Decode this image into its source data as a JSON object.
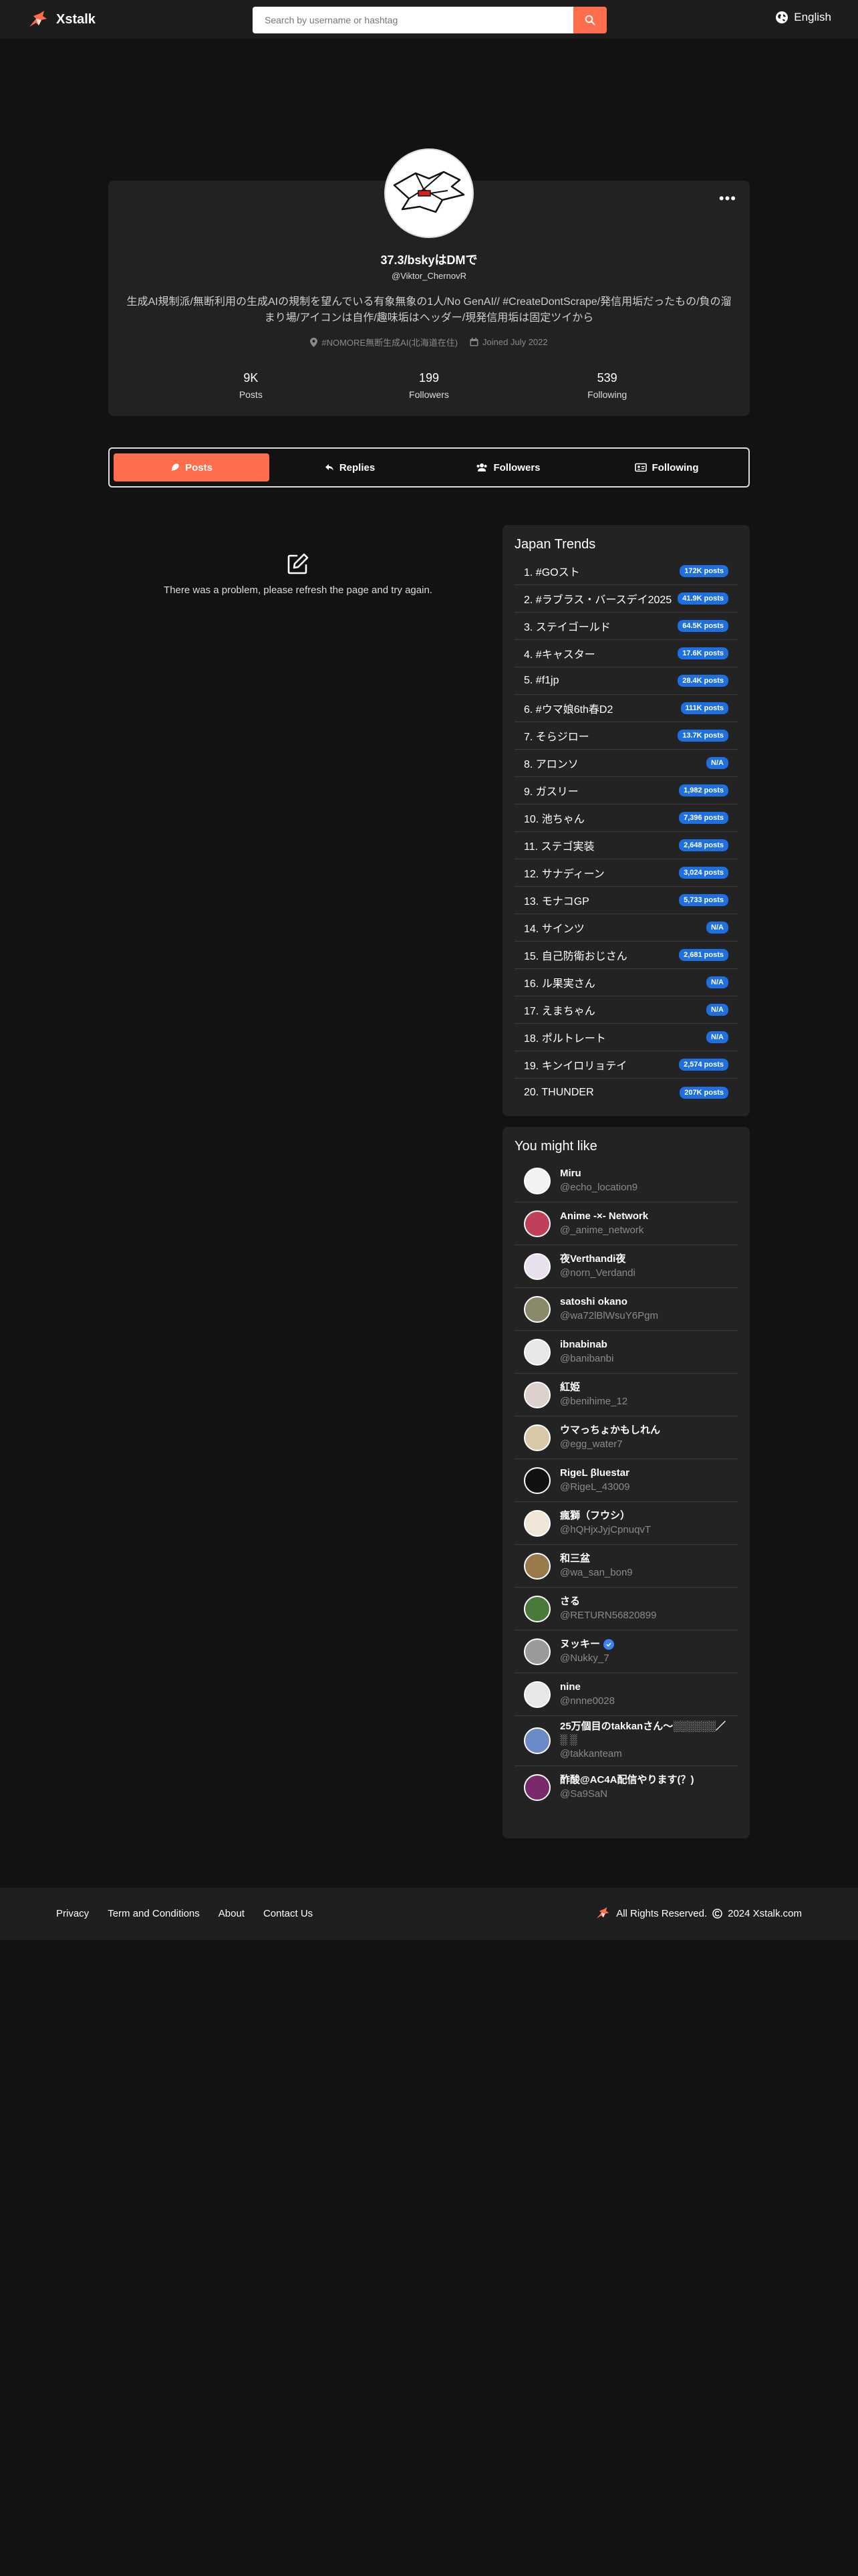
{
  "header": {
    "brand": "Xstalk",
    "search_placeholder": "Search by username or hashtag",
    "language": "English"
  },
  "profile": {
    "display_name": "37.3/bskyはDMで",
    "handle": "@Viktor_ChernovR",
    "bio": "生成AI規制派/無断利用の生成AIの規制を望んでいる有象無象の1人/No GenAI// #CreateDontScrape/発信用垢だったもの/負の溜まり場/アイコンは自作/趣味垢はヘッダー/現発信用垢は固定ツイから",
    "location": "#NOMORE無断生成AI(北海道在住)",
    "joined": "Joined July 2022",
    "stats": [
      {
        "value": "9K",
        "label": "Posts"
      },
      {
        "value": "199",
        "label": "Followers"
      },
      {
        "value": "539",
        "label": "Following"
      }
    ]
  },
  "tabs": [
    {
      "label": "Posts",
      "icon": "feather-icon",
      "active": true
    },
    {
      "label": "Replies",
      "icon": "reply-icon",
      "active": false
    },
    {
      "label": "Followers",
      "icon": "users-icon",
      "active": false
    },
    {
      "label": "Following",
      "icon": "id-card-icon",
      "active": false
    }
  ],
  "error_message": "There was a problem, please refresh the page and try again.",
  "trends": {
    "title": "Japan Trends",
    "items": [
      {
        "name": "1. #GOスト",
        "count": "172K posts"
      },
      {
        "name": "2. #ラブラス・バースデイ2025",
        "count": "41.9K posts"
      },
      {
        "name": "3. ステイゴールド",
        "count": "64.5K posts"
      },
      {
        "name": "4. #キャスター",
        "count": "17.6K posts"
      },
      {
        "name": "5. #f1jp",
        "count": "28.4K posts"
      },
      {
        "name": "6. #ウマ娘6th春D2",
        "count": "111K posts"
      },
      {
        "name": "7. そらジロー",
        "count": "13.7K posts"
      },
      {
        "name": "8. アロンソ",
        "count": "N/A"
      },
      {
        "name": "9. ガスリー",
        "count": "1,982 posts"
      },
      {
        "name": "10. 池ちゃん",
        "count": "7,396 posts"
      },
      {
        "name": "11. ステゴ実装",
        "count": "2,648 posts"
      },
      {
        "name": "12. サナディーン",
        "count": "3,024 posts"
      },
      {
        "name": "13. モナコGP",
        "count": "5,733 posts"
      },
      {
        "name": "14. サインツ",
        "count": "N/A"
      },
      {
        "name": "15. 自己防衛おじさん",
        "count": "2,681 posts"
      },
      {
        "name": "16. ル果実さん",
        "count": "N/A"
      },
      {
        "name": "17. えまちゃん",
        "count": "N/A"
      },
      {
        "name": "18. ポルトレート",
        "count": "N/A"
      },
      {
        "name": "19. キンイロリョテイ",
        "count": "2,574 posts"
      },
      {
        "name": "20. THUNDER",
        "count": "207K posts"
      }
    ]
  },
  "suggest": {
    "title": "You might like",
    "users": [
      {
        "name": "Miru",
        "handle": "@echo_location9",
        "color": "#f2f2f2",
        "verified": false
      },
      {
        "name": "Anime -×- Network",
        "handle": "@_anime_network",
        "color": "#c0405a",
        "verified": false
      },
      {
        "name": "夜Verthandi夜",
        "handle": "@norn_Verdandi",
        "color": "#e8e0ec",
        "verified": false
      },
      {
        "name": "satoshi okano",
        "handle": "@wa72lBlWsuY6Pgm",
        "color": "#8a8a6a",
        "verified": false
      },
      {
        "name": "ibnabinab",
        "handle": "@banibanbi",
        "color": "#e8e8e8",
        "verified": false
      },
      {
        "name": "紅姫",
        "handle": "@benihime_12",
        "color": "#ddd0cc",
        "verified": false
      },
      {
        "name": "ウマっちょかもしれん",
        "handle": "@egg_water7",
        "color": "#d8c8a8",
        "verified": false
      },
      {
        "name": "RigeL βluestar",
        "handle": "@RigeL_43009",
        "color": "#111111",
        "verified": false
      },
      {
        "name": "瘋獅（フウシ）",
        "handle": "@hQHjxJyjCpnuqvT",
        "color": "#f0e6d8",
        "verified": false
      },
      {
        "name": "和三盆",
        "handle": "@wa_san_bon9",
        "color": "#9a7a4a",
        "verified": false
      },
      {
        "name": "さる",
        "handle": "@RETURN56820899",
        "color": "#4a7a3a",
        "verified": false
      },
      {
        "name": "ヌッキー",
        "handle": "@Nukky_7",
        "color": "#9a9a9a",
        "verified": true
      },
      {
        "name": "nine",
        "handle": "@nnne0028",
        "color": "#e8e8e8",
        "verified": false
      },
      {
        "name": "25万個目のtakkanさん〜░░░░░░／ ░ ░",
        "handle": "@takkanteam",
        "color": "#6a8ac8",
        "verified": false
      },
      {
        "name": "酢酸@AC4A配信やります(？)",
        "handle": "@Sa9SaN",
        "color": "#7a2a6a",
        "verified": false
      }
    ]
  },
  "footer": {
    "links": [
      "Privacy",
      "Term and Conditions",
      "About",
      "Contact Us"
    ],
    "rights": "All Rights Reserved.",
    "copyright": "2024 Xstalk.com"
  },
  "colors": {
    "accent": "#ff6d4d",
    "badge": "#1e6fe0",
    "background": "#121212",
    "panel": "#232323"
  }
}
